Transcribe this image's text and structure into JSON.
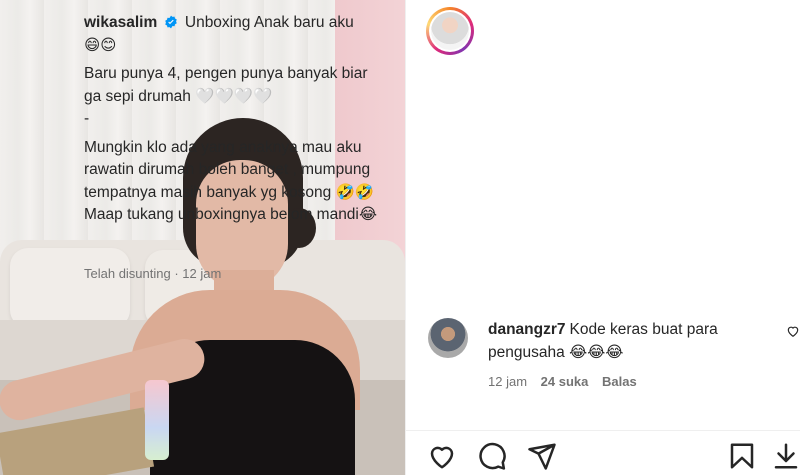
{
  "post": {
    "username": "wikasalim",
    "title_text": "Unboxing Anak baru aku",
    "lines": [
      "😄😊",
      "Baru punya 4, pengen punya banyak biar ga sepi drumah 🤍🤍🤍🤍",
      "-",
      "Mungkin klo ada yang anaknya mau aku rawatin dirumah boleh banget , mumpung tempatnya masih banyak yg kosong 🤣🤣",
      "Maap tukang unboxingnya belom mandi😂"
    ],
    "edited_label": "Telah disunting · 12 jam"
  },
  "comment": {
    "username": "danangzr7",
    "text": "Kode keras buat para pengusaha 😂😂😂",
    "time": "12 jam",
    "likes": "24 suka",
    "reply": "Balas"
  },
  "icons": {
    "like": "heart-icon",
    "comment": "comment-icon",
    "share": "share-icon",
    "save": "bookmark-icon",
    "verified": "verified-badge-icon"
  },
  "colors": {
    "accent": "#0095f6",
    "text": "#262626",
    "muted": "#737373"
  }
}
